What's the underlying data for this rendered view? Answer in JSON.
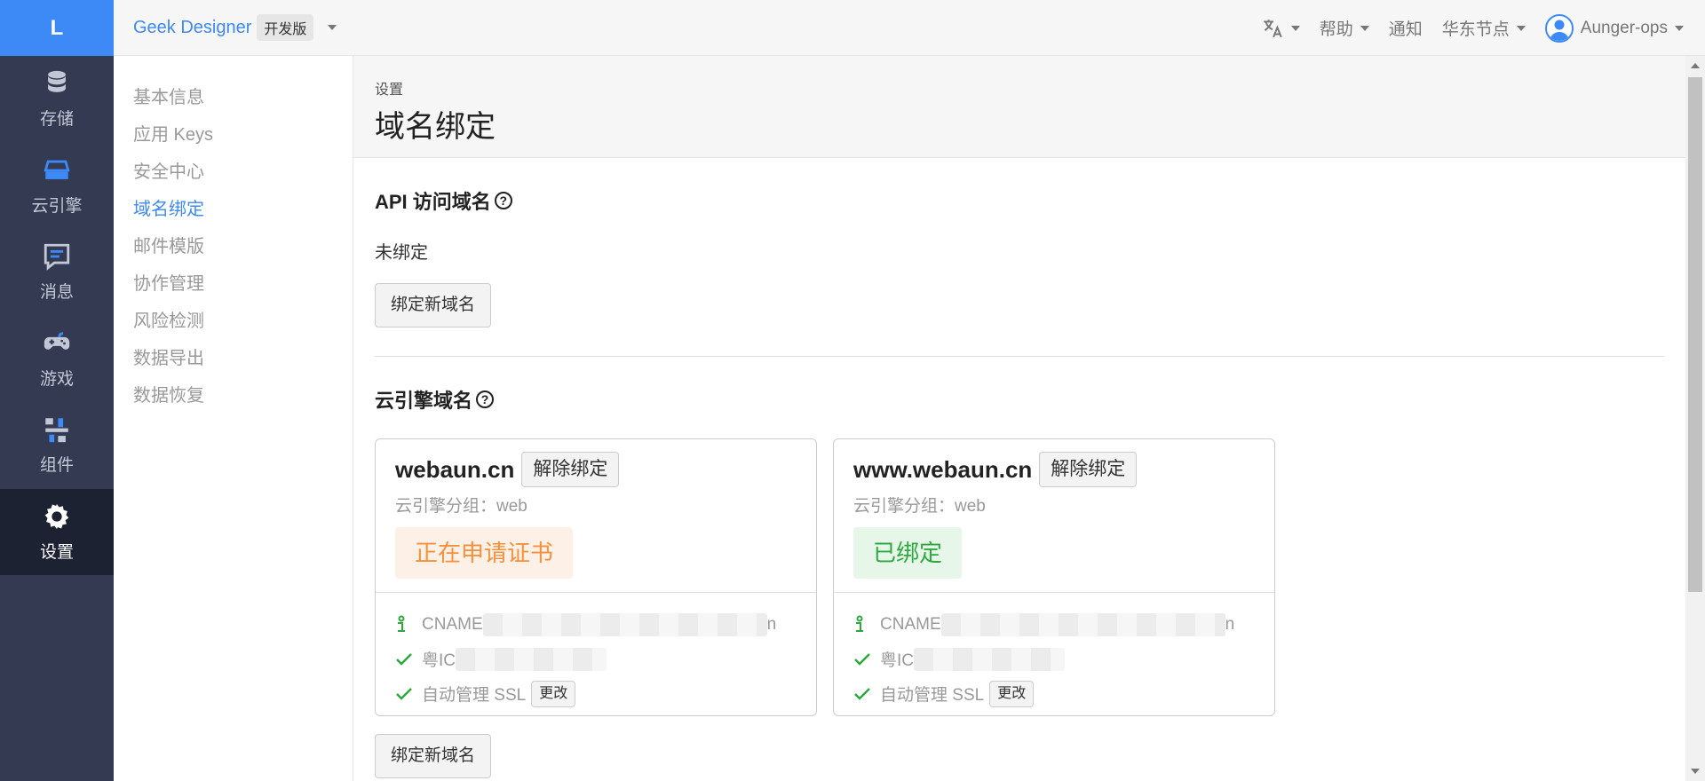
{
  "logo": "L",
  "nav": [
    {
      "label": "存储",
      "icon": "database-icon"
    },
    {
      "label": "云引擎",
      "icon": "server-icon"
    },
    {
      "label": "消息",
      "icon": "message-icon"
    },
    {
      "label": "游戏",
      "icon": "gamepad-icon"
    },
    {
      "label": "组件",
      "icon": "components-icon"
    },
    {
      "label": "设置",
      "icon": "gear-icon",
      "active": true
    }
  ],
  "topbar": {
    "app_name": "Geek Designer",
    "env": "开发版",
    "help": "帮助",
    "notify": "通知",
    "region": "华东节点",
    "user": "Aunger-ops"
  },
  "subnav": [
    "基本信息",
    "应用 Keys",
    "安全中心",
    "域名绑定",
    "邮件模版",
    "协作管理",
    "风险检测",
    "数据导出",
    "数据恢复"
  ],
  "subnav_active": "域名绑定",
  "page": {
    "crumb": "设置",
    "title": "域名绑定"
  },
  "api_section": {
    "title": "API 访问域名",
    "status": "未绑定",
    "button": "绑定新域名"
  },
  "engine_section": {
    "title": "云引擎域名",
    "button": "绑定新域名",
    "cards": [
      {
        "domain": "webaun.cn",
        "unbind": "解除绑定",
        "group": "云引擎分组：web",
        "status": "正在申请证书",
        "status_type": "pending",
        "cname_prefix": "CNAME",
        "cname_suffix": "n",
        "icp_prefix": "粤IC",
        "ssl": "自动管理 SSL",
        "change": "更改"
      },
      {
        "domain": "www.webaun.cn",
        "unbind": "解除绑定",
        "group": "云引擎分组：web",
        "status": "已绑定",
        "status_type": "bound",
        "cname_prefix": "CNAME",
        "cname_suffix": "n",
        "icp_prefix": "粤IC",
        "ssl": "自动管理 SSL",
        "change": "更改"
      }
    ]
  },
  "colors": {
    "accent": "#3d8af7",
    "nav_bg": "#333a52",
    "pending": "#f5913c",
    "bound": "#2fa83f"
  }
}
